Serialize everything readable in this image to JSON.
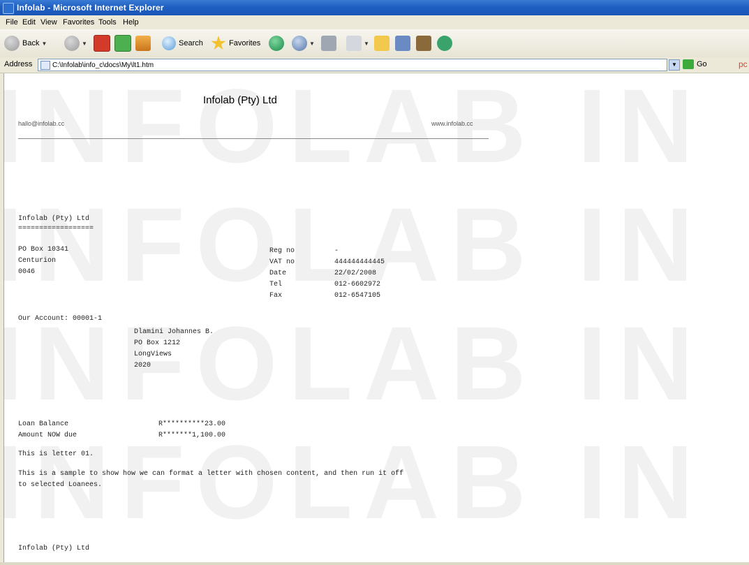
{
  "window": {
    "title": "Infolab - Microsoft Internet Explorer"
  },
  "menu": [
    "File",
    "Edit",
    "View",
    "Favorites",
    "Tools",
    "Help"
  ],
  "toolbar": {
    "back_label": "Back",
    "search_label": "Search",
    "favorites_label": "Favorites"
  },
  "address": {
    "label": "Address",
    "value": "C:\\Infolab\\info_c\\docs\\My\\lt1.htm",
    "go_label": "Go",
    "extra": "pc"
  },
  "page": {
    "header_title": "Infolab (Pty) Ltd",
    "email": "hallo@infolab.cc",
    "website": "www.infolab.cc",
    "watermark": [
      "INFOLAB IN",
      "INFOLAB IN",
      "INFOLAB IN",
      "INFOLAB IN"
    ],
    "company_name": "Infolab (Pty) Ltd",
    "company_underline": "==================",
    "address_lines": [
      "PO Box 10341",
      "Centurion",
      "0046"
    ],
    "details": [
      {
        "label": "Reg no",
        "value": "-"
      },
      {
        "label": "VAT no",
        "value": "444444444445"
      },
      {
        "label": "Date",
        "value": "22/02/2008"
      },
      {
        "label": "Tel",
        "value": "012-6602972"
      },
      {
        "label": "Fax",
        "value": "012-6547105"
      }
    ],
    "account_line": "Our Account: 00001-1",
    "recipient_lines": [
      "Dlamini Johannes B.",
      "PO Box 1212",
      "LongViews",
      "2020"
    ],
    "loan_balance_label": "Loan Balance",
    "loan_balance_value": "R**********23.00",
    "amount_due_label": "Amount NOW due",
    "amount_due_value": "R*******1,100.00",
    "letter_line": "This is letter 01.",
    "body_line1": "This is a sample to show how we can format a letter with chosen content, and then run it off",
    "body_line2": "to selected Loanees.",
    "footer_company": "Infolab (Pty) Ltd"
  }
}
